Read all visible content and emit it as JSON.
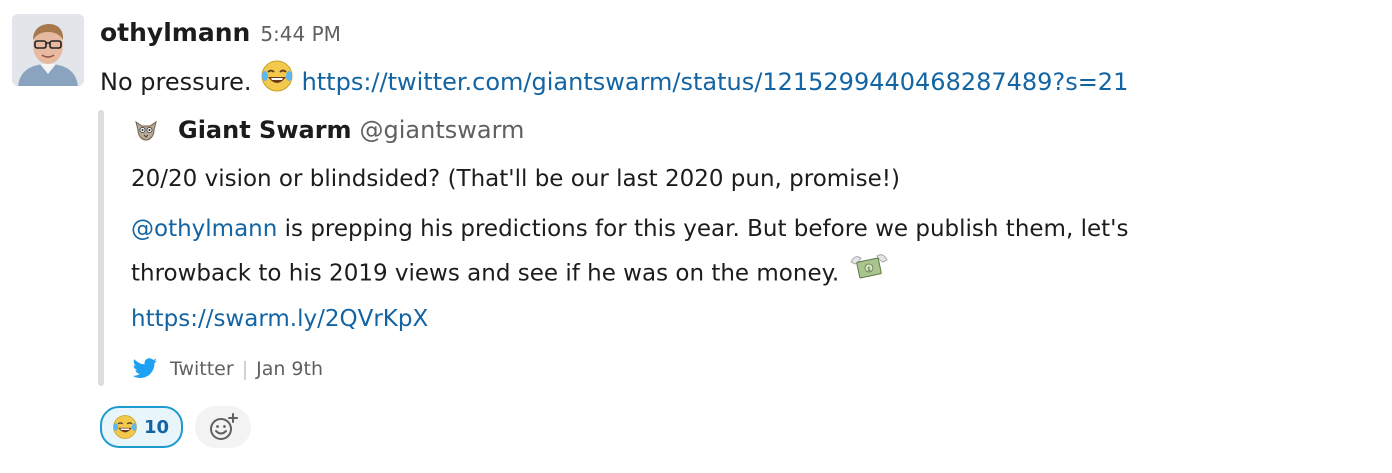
{
  "message": {
    "author": "othylmann",
    "time": "5:44 PM",
    "text": "No pressure.",
    "inline_emoji": "joy-emoji",
    "link": "https://twitter.com/giantswarm/status/1215299440468287489?s=21"
  },
  "attachment": {
    "author_name": "Giant Swarm",
    "author_handle": "@giantswarm",
    "paragraph1": "20/20 vision or blindsided? (That'll be our last 2020 pun, promise!)",
    "mention": "@othylmann",
    "paragraph2_line1_rest": " is prepping his predictions for this year. But before we publish them, let's",
    "paragraph2_line2": "throwback to his 2019 views and see if he was on the money.",
    "money_emoji": "money-with-wings-emoji",
    "short_link": "https://swarm.ly/2QVrKpX",
    "footer_source": "Twitter",
    "footer_separator": "|",
    "footer_date": "Jan 9th",
    "footer_icon": "twitter-bird-icon",
    "author_icon": "giant-swarm-logo-icon"
  },
  "reactions": [
    {
      "emoji": "joy-emoji",
      "count": "10",
      "selected": true
    }
  ],
  "add_reaction_icon": "add-reaction-icon",
  "colors": {
    "link": "#1264a3",
    "reaction_border": "#1d9bd1",
    "reaction_bg": "#e8f5fa",
    "muted_text": "#616061",
    "attachment_bar": "#dddddd",
    "twitter_blue": "#1da1f2"
  }
}
